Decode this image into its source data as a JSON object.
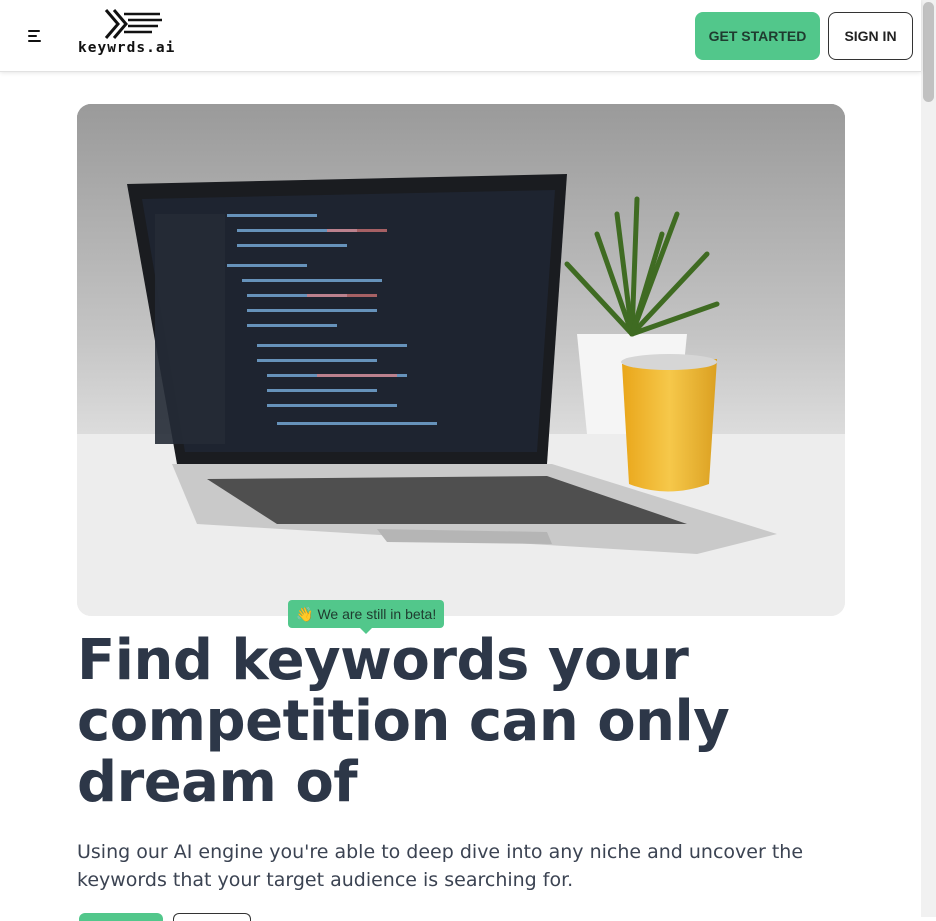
{
  "nav": {
    "menu_icon": "hamburger-menu-icon",
    "logo_text": "keywrds.ai",
    "get_started_label": "GET STARTED",
    "sign_in_label": "SIGN IN"
  },
  "hero": {
    "image_alt": "laptop-with-code-and-plant",
    "beta_emoji": "👋",
    "beta_text": "We are still in beta!",
    "headline": "Find keywords your competition can only dream of",
    "subtext": "Using our AI engine you're able to deep dive into any niche and uncover the keywords that your target audience is searching for."
  },
  "colors": {
    "accent": "#52c78b",
    "heading": "#2d3748"
  }
}
